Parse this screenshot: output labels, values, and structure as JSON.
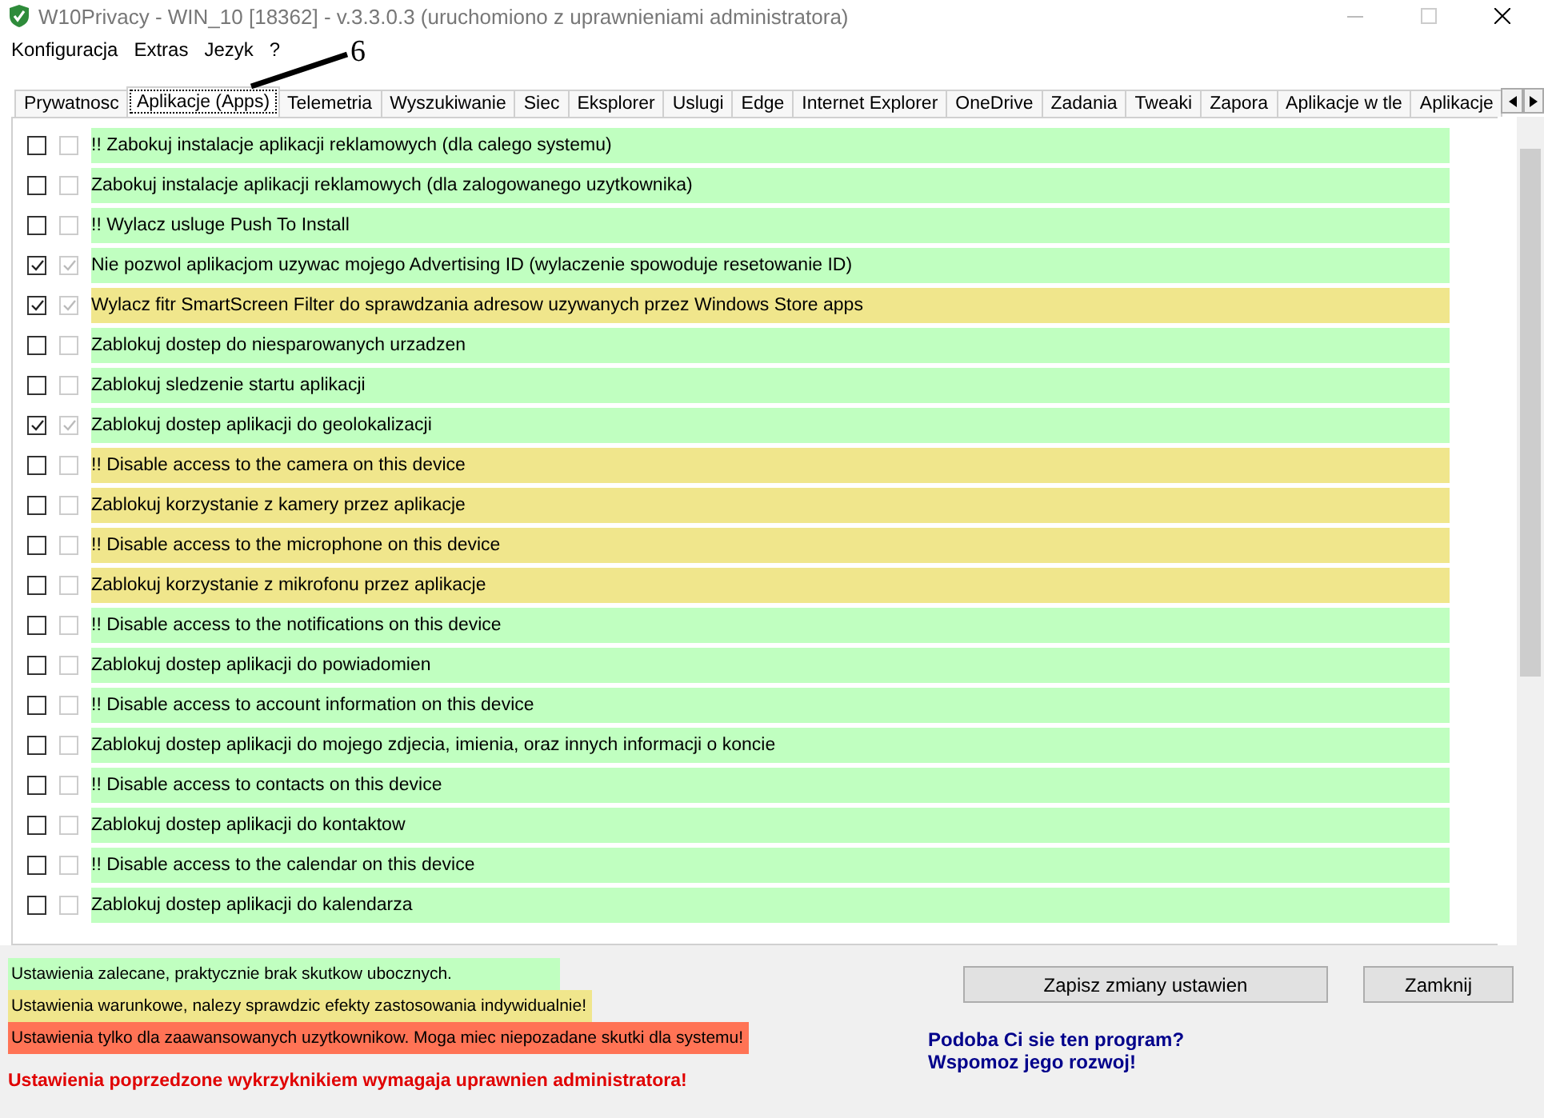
{
  "window": {
    "title": "W10Privacy - WIN_10 [18362]  - v.3.3.0.3 (uruchomiono z uprawnieniami administratora)"
  },
  "menu": [
    "Konfiguracja",
    "Extras",
    "Jezyk",
    "?"
  ],
  "annotation": {
    "label": "6"
  },
  "tabs": [
    {
      "label": "Prywatnosc",
      "selected": false
    },
    {
      "label": "Aplikacje (Apps)",
      "selected": true
    },
    {
      "label": "Telemetria",
      "selected": false
    },
    {
      "label": "Wyszukiwanie",
      "selected": false
    },
    {
      "label": "Siec",
      "selected": false
    },
    {
      "label": "Eksplorer",
      "selected": false
    },
    {
      "label": "Uslugi",
      "selected": false
    },
    {
      "label": "Edge",
      "selected": false
    },
    {
      "label": "Internet Explorer",
      "selected": false
    },
    {
      "label": "OneDrive",
      "selected": false
    },
    {
      "label": "Zadania",
      "selected": false
    },
    {
      "label": "Tweaki",
      "selected": false
    },
    {
      "label": "Zapora",
      "selected": false
    },
    {
      "label": "Aplikacje w tle",
      "selected": false
    },
    {
      "label": "Aplikacje",
      "selected": false
    }
  ],
  "settings": [
    {
      "label": "!! Zabokuj instalacje aplikacji reklamowych (dla calego systemu)",
      "checked": false,
      "color": "#c0ffc0"
    },
    {
      "label": "Zabokuj instalacje aplikacji reklamowych (dla zalogowanego uzytkownika)",
      "checked": false,
      "color": "#c0ffc0"
    },
    {
      "label": "!! Wylacz usluge Push To Install",
      "checked": false,
      "color": "#c0ffc0"
    },
    {
      "label": "Nie pozwol aplikacjom uzywac mojego Advertising ID (wylaczenie spowoduje resetowanie ID)",
      "checked": true,
      "color": "#c0ffc0"
    },
    {
      "label": "Wylacz fitr SmartScreen Filter do sprawdzania adresow uzywanych przez Windows Store apps",
      "checked": true,
      "color": "#f0e68c"
    },
    {
      "label": "Zablokuj dostep do niesparowanych urzadzen",
      "checked": false,
      "color": "#c0ffc0"
    },
    {
      "label": "Zablokuj sledzenie startu aplikacji",
      "checked": false,
      "color": "#c0ffc0"
    },
    {
      "label": "Zablokuj dostep aplikacji do geolokalizacji",
      "checked": true,
      "color": "#c0ffc0"
    },
    {
      "label": "!! Disable access to the camera on this device",
      "checked": false,
      "color": "#f0e68c"
    },
    {
      "label": "Zablokuj korzystanie z kamery przez aplikacje",
      "checked": false,
      "color": "#f0e68c"
    },
    {
      "label": "!! Disable access to the microphone on this device",
      "checked": false,
      "color": "#f0e68c"
    },
    {
      "label": "Zablokuj korzystanie z mikrofonu przez aplikacje",
      "checked": false,
      "color": "#f0e68c"
    },
    {
      "label": "!! Disable access to the notifications on this device",
      "checked": false,
      "color": "#c0ffc0"
    },
    {
      "label": "Zablokuj dostep aplikacji do powiadomien",
      "checked": false,
      "color": "#c0ffc0"
    },
    {
      "label": "!! Disable access to account information on this device",
      "checked": false,
      "color": "#c0ffc0"
    },
    {
      "label": "Zablokuj dostep aplikacji do mojego zdjecia, imienia, oraz innych informacji o koncie",
      "checked": false,
      "color": "#c0ffc0"
    },
    {
      "label": "!! Disable access to contacts on this device",
      "checked": false,
      "color": "#c0ffc0"
    },
    {
      "label": "Zablokuj dostep aplikacji do kontaktow",
      "checked": false,
      "color": "#c0ffc0"
    },
    {
      "label": "!! Disable access to the calendar on this device",
      "checked": false,
      "color": "#c0ffc0"
    },
    {
      "label": "Zablokuj dostep aplikacji do kalendarza",
      "checked": false,
      "color": "#c0ffc0"
    }
  ],
  "legend": [
    {
      "label": "Ustawienia zalecane, praktycznie brak skutkow ubocznych.",
      "color": "#c0ffc0"
    },
    {
      "label": "Ustawienia warunkowe, nalezy sprawdzic efekty zastosowania indywidualnie!",
      "color": "#f0e68c"
    },
    {
      "label": "Ustawienia tylko dla zaawansowanych uzytkownikow. Moga miec niepozadane skutki dla systemu!",
      "color": "#ff7355"
    }
  ],
  "admin_note": "Ustawienia poprzedzone wykrzyknikiem wymagaja uprawnien administratora!",
  "buttons": [
    "Zapisz zmiany ustawien",
    "Zamknij"
  ],
  "support_links": [
    "Podoba Ci sie ten program?",
    "Wspomoz jego rozwoj!"
  ]
}
